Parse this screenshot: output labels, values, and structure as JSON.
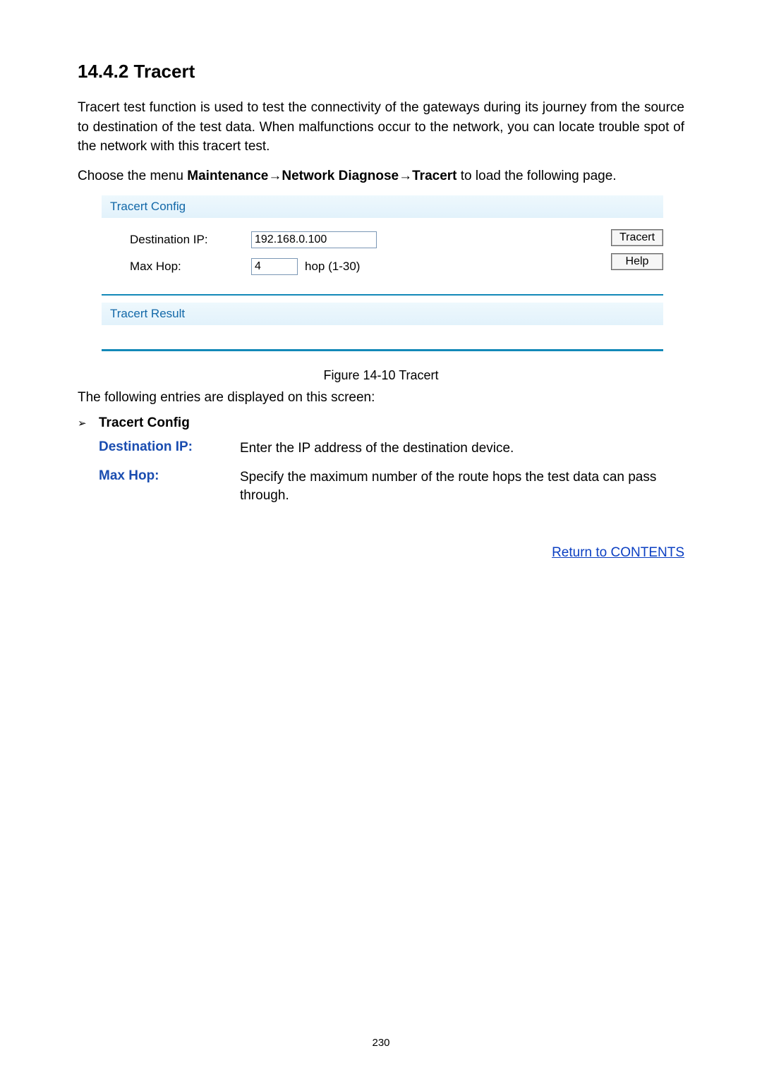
{
  "heading": "14.4.2  Tracert",
  "intro_paragraph": "Tracert test function is used to test the connectivity of the gateways during its journey from the source to destination of the test data. When malfunctions occur to the network, you can locate trouble spot of the network with this tracert test.",
  "nav_sentence_prefix": "Choose the menu ",
  "nav_bold_1": "Maintenance",
  "nav_arrow": "→",
  "nav_bold_2": "Network Diagnose",
  "nav_bold_3": "Tracert",
  "nav_sentence_suffix": " to load the following page.",
  "panel": {
    "config_title": "Tracert Config",
    "dest_label": "Destination IP:",
    "dest_value": "192.168.0.100",
    "maxhop_label": "Max Hop:",
    "maxhop_value": "4",
    "maxhop_hint": "hop (1-30)",
    "btn_tracert": "Tracert",
    "btn_help": "Help",
    "result_title": "Tracert Result"
  },
  "figure_caption": "Figure 14-10 Tracert",
  "entries_intro": "The following entries are displayed on this screen:",
  "bullet_label": "Tracert Config",
  "definitions": [
    {
      "term": "Destination IP:",
      "desc": "Enter the IP address of the destination device."
    },
    {
      "term": "Max Hop:",
      "desc": "Specify the maximum number of the route hops the test data can pass through."
    }
  ],
  "return_link": "Return to CONTENTS",
  "page_number": "230"
}
